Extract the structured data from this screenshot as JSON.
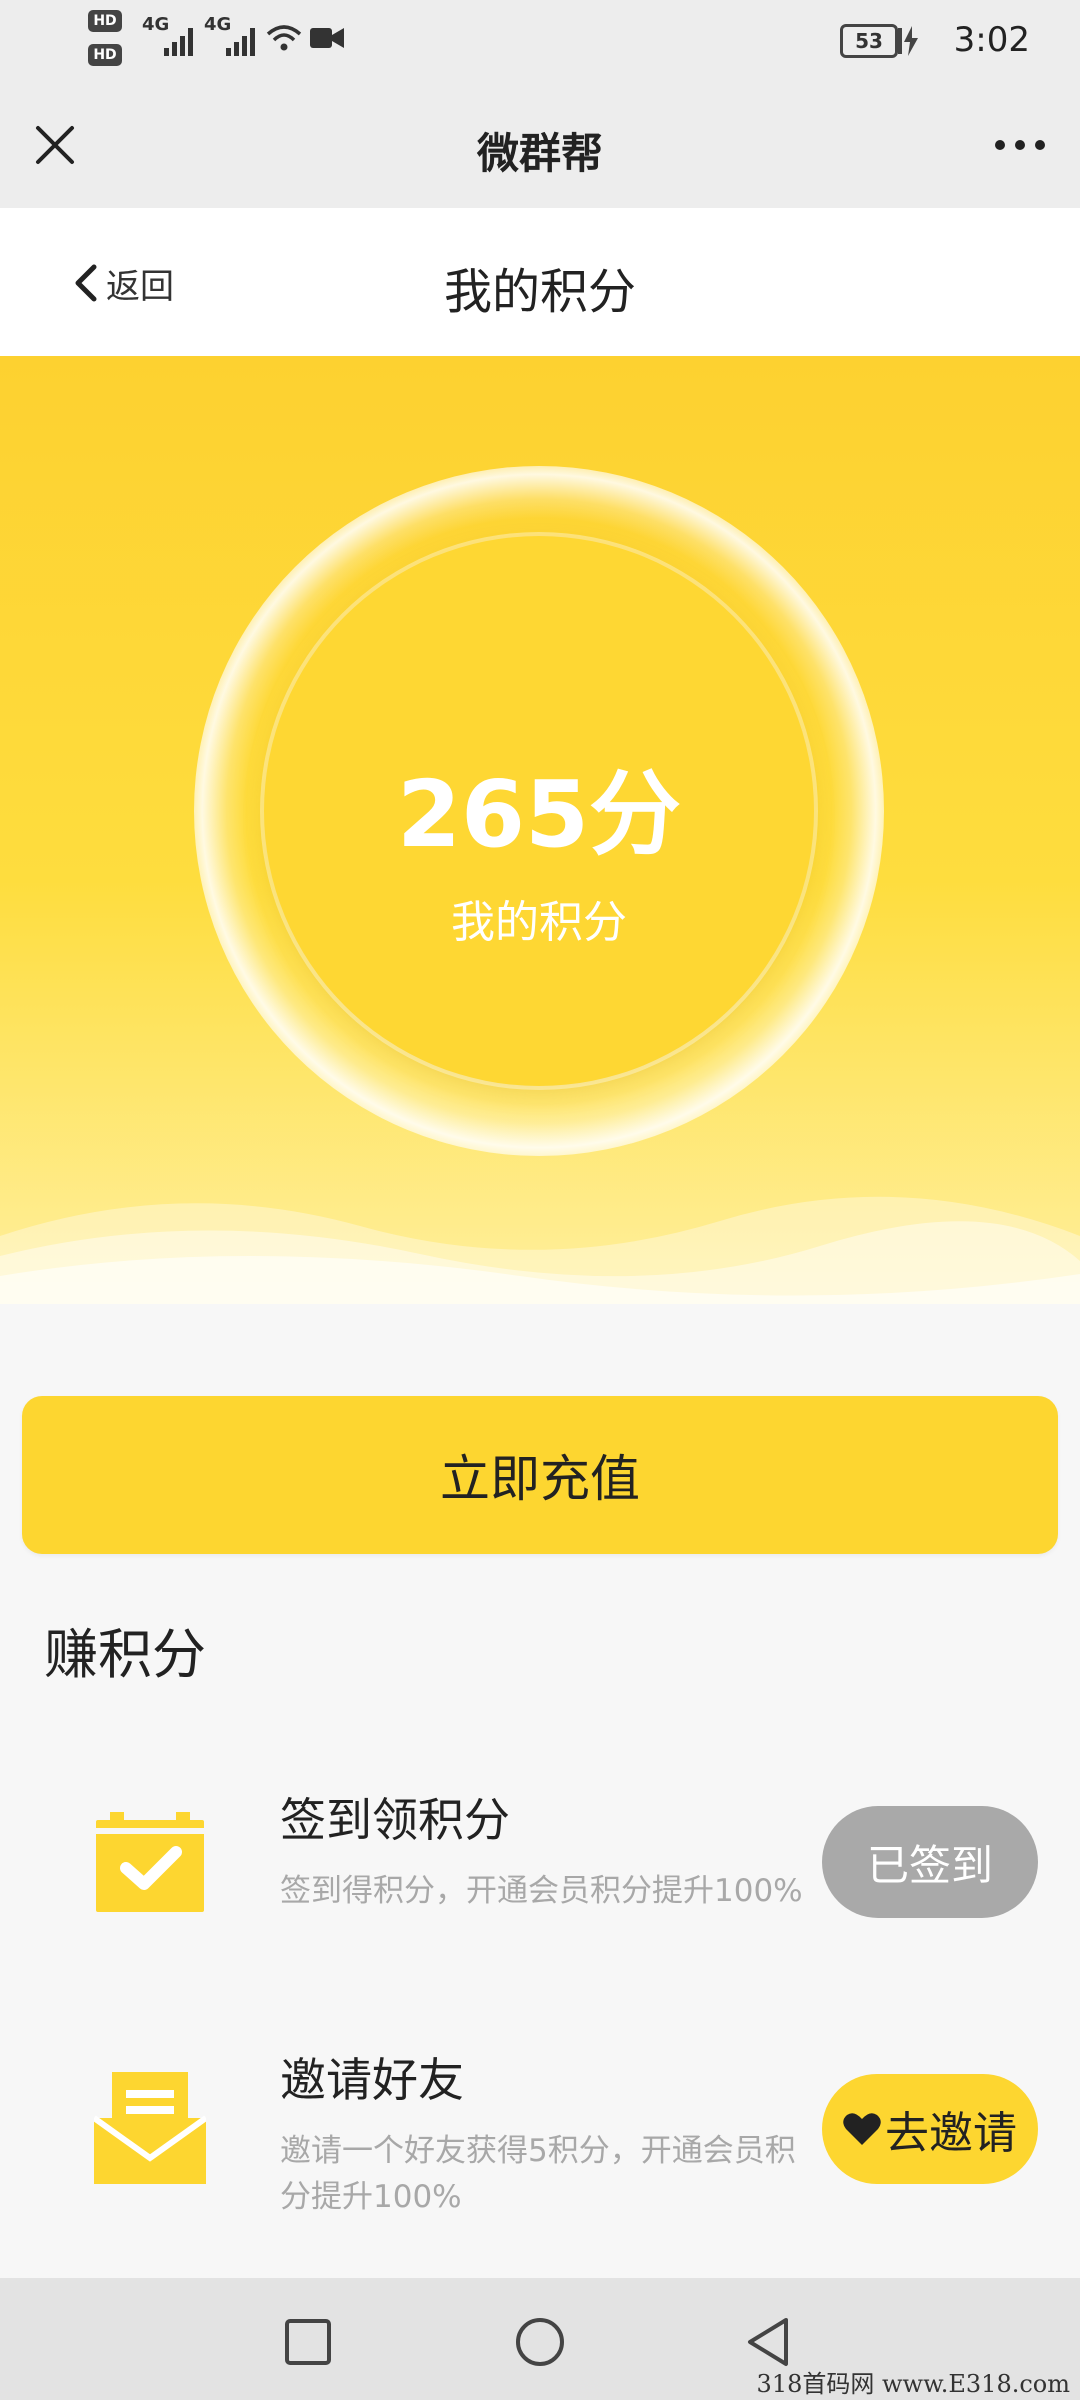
{
  "status_bar": {
    "hd_1": "HD",
    "hd_2": "HD",
    "signal_1": "4G",
    "signal_2": "4G",
    "battery": "53",
    "time": "3:02"
  },
  "wechat_bar": {
    "title": "微群帮",
    "close_icon": "close-icon",
    "more_icon": "more-icon"
  },
  "header": {
    "back_label": "返回",
    "title": "我的积分"
  },
  "points": {
    "value": "265分",
    "label": "我的积分"
  },
  "recharge": {
    "label": "立即充值"
  },
  "earn": {
    "section_title": "赚积分",
    "tasks": [
      {
        "icon": "calendar-check-icon",
        "title": "签到领积分",
        "desc": "签到得积分，开通会员积分提升100%",
        "action": "已签到",
        "action_state": "disabled"
      },
      {
        "icon": "envelope-icon",
        "title": "邀请好友",
        "desc": "邀请一个好友获得5积分，开通会员积分提升100%",
        "action": "去邀请",
        "action_icon": "heart-icon"
      }
    ]
  },
  "nav": {
    "recent_icon": "square-icon",
    "home_icon": "circle-icon",
    "back_icon": "triangle-back-icon"
  },
  "watermark": "318首码网 www.E318.com",
  "colors": {
    "accent_yellow": "#fdd630",
    "disabled_gray": "#a9a9a9"
  }
}
